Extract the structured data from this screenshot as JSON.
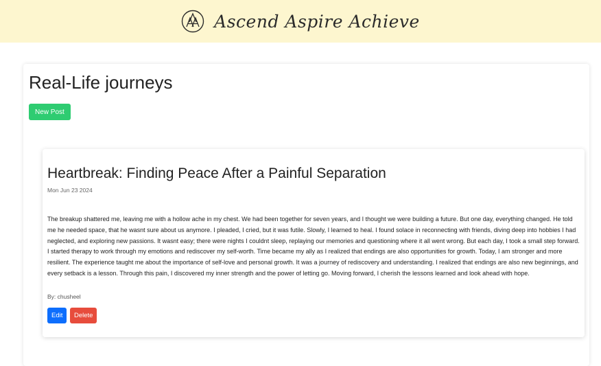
{
  "header": {
    "brand_name": "Ascend Aspire Achieve",
    "logo_icon": "triple-a-logo-icon"
  },
  "page": {
    "title": "Real-Life journeys",
    "new_post_label": "New Post"
  },
  "colors": {
    "header_bg": "#fdf6cf",
    "new_post_bg": "#2ecc71",
    "edit_bg": "#0d6efd",
    "delete_bg": "#e74c3c"
  },
  "posts": [
    {
      "title": "Heartbreak: Finding Peace After a Painful Separation",
      "date": "Mon Jun 23 2024",
      "body": "The breakup shattered me, leaving me with a hollow ache in my chest. We had been together for seven years, and I thought we were building a future. But one day, everything changed. He told me he needed space, that he wasnt sure about us anymore. I pleaded, I cried, but it was futile. Slowly, I learned to heal. I found solace in reconnecting with friends, diving deep into hobbies I had neglected, and exploring new passions. It wasnt easy; there were nights I couldnt sleep, replaying our memories and questioning where it all went wrong. But each day, I took a small step forward. I started therapy to work through my emotions and rediscover my self-worth. Time became my ally as I realized that endings are also opportunities for growth. Today, I am stronger and more resilient. The experience taught me about the importance of self-love and personal growth. It was a journey of rediscovery and understanding. I realized that endings are also new beginnings, and every setback is a lesson. Through this pain, I discovered my inner strength and the power of letting go. Moving forward, I cherish the lessons learned and look ahead with hope.",
      "author": "By: chusheel",
      "edit_label": "Edit",
      "delete_label": "Delete"
    }
  ]
}
